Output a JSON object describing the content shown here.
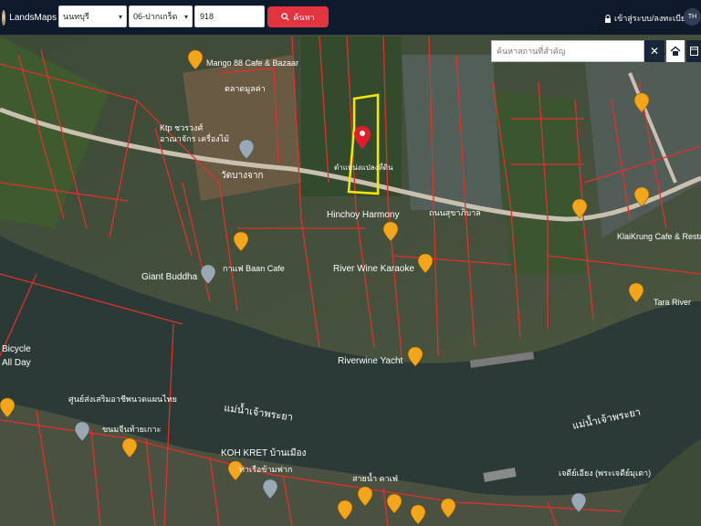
{
  "header": {
    "logo_text": "LandsMaps",
    "province": "นนทบุรี",
    "district": "06-ปากเกร็ด",
    "parcel_number": "918",
    "search_label": "ค้นหา",
    "login_label": "เข้าสู่ระบบ/ลงทะเบียน",
    "language": "TH"
  },
  "map": {
    "place_search_placeholder": "ค้นหาสถานที่สำคัญ",
    "parcel_label": "ตำแหน่งแปลงที่ดิน",
    "river_labels": [
      "แม่น้ำเจ้าพระยา",
      "แม่น้ำเจ้าพระยา"
    ],
    "place_labels": [
      "Mango 88 Cafe & Bazaar",
      "ตลาดมูลค่า",
      "Ktp ชวรวงศ์",
      "อาณาจักร เครื่องไม้",
      "วัดบางจาก",
      "Hinchoy Harmony",
      "Giant Buddha",
      "กาแฟ Baan Cafe",
      "River Wine Karaoke",
      "Riverwine Yacht",
      "KlaiKrung Cafe & Restaurant",
      "Tara River",
      "ศูนย์ส่งเสริมอาชีพนวดแผนไทย",
      "ขนมจีนท้ายเกาะ",
      "KOH KRET บ้านเมือง",
      "ท่าเรือข้ามฟาก",
      "สายน้ำ คาเฟ่",
      "เจดีย์เอียง (พระเจดีย์มุเตา)",
      "Bicycle",
      "All Day",
      "ถนนสุขาภิบาล"
    ]
  },
  "colors": {
    "topbar": "#0e1a2b",
    "search_button": "#e2343f",
    "parcel_lines": "#e0302b",
    "target_parcel": "#f5e800",
    "pin_marker": "#f3a51b",
    "river": "#2a3a38"
  }
}
